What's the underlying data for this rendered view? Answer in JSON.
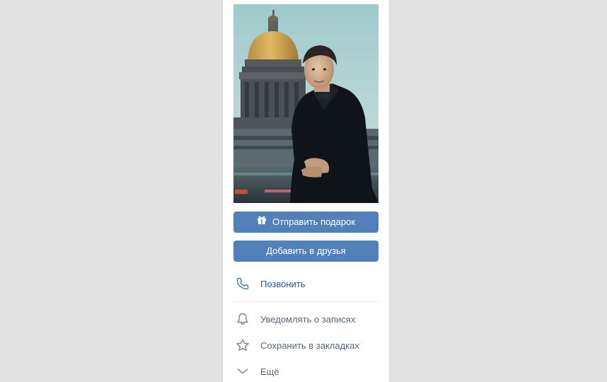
{
  "profile": {
    "gift_button_label": "Отправить подарок",
    "add_friend_button_label": "Добавить в друзья"
  },
  "actions": {
    "call_label": "Позвонить",
    "notify_label": "Уведомлять о записях",
    "bookmark_label": "Сохранить в закладках",
    "more_label": "Ещё"
  },
  "colors": {
    "accent": "#5181b8",
    "link": "#2a5885",
    "muted": "#55677d",
    "icon": "#828a99",
    "background": "#e1e1e1"
  }
}
